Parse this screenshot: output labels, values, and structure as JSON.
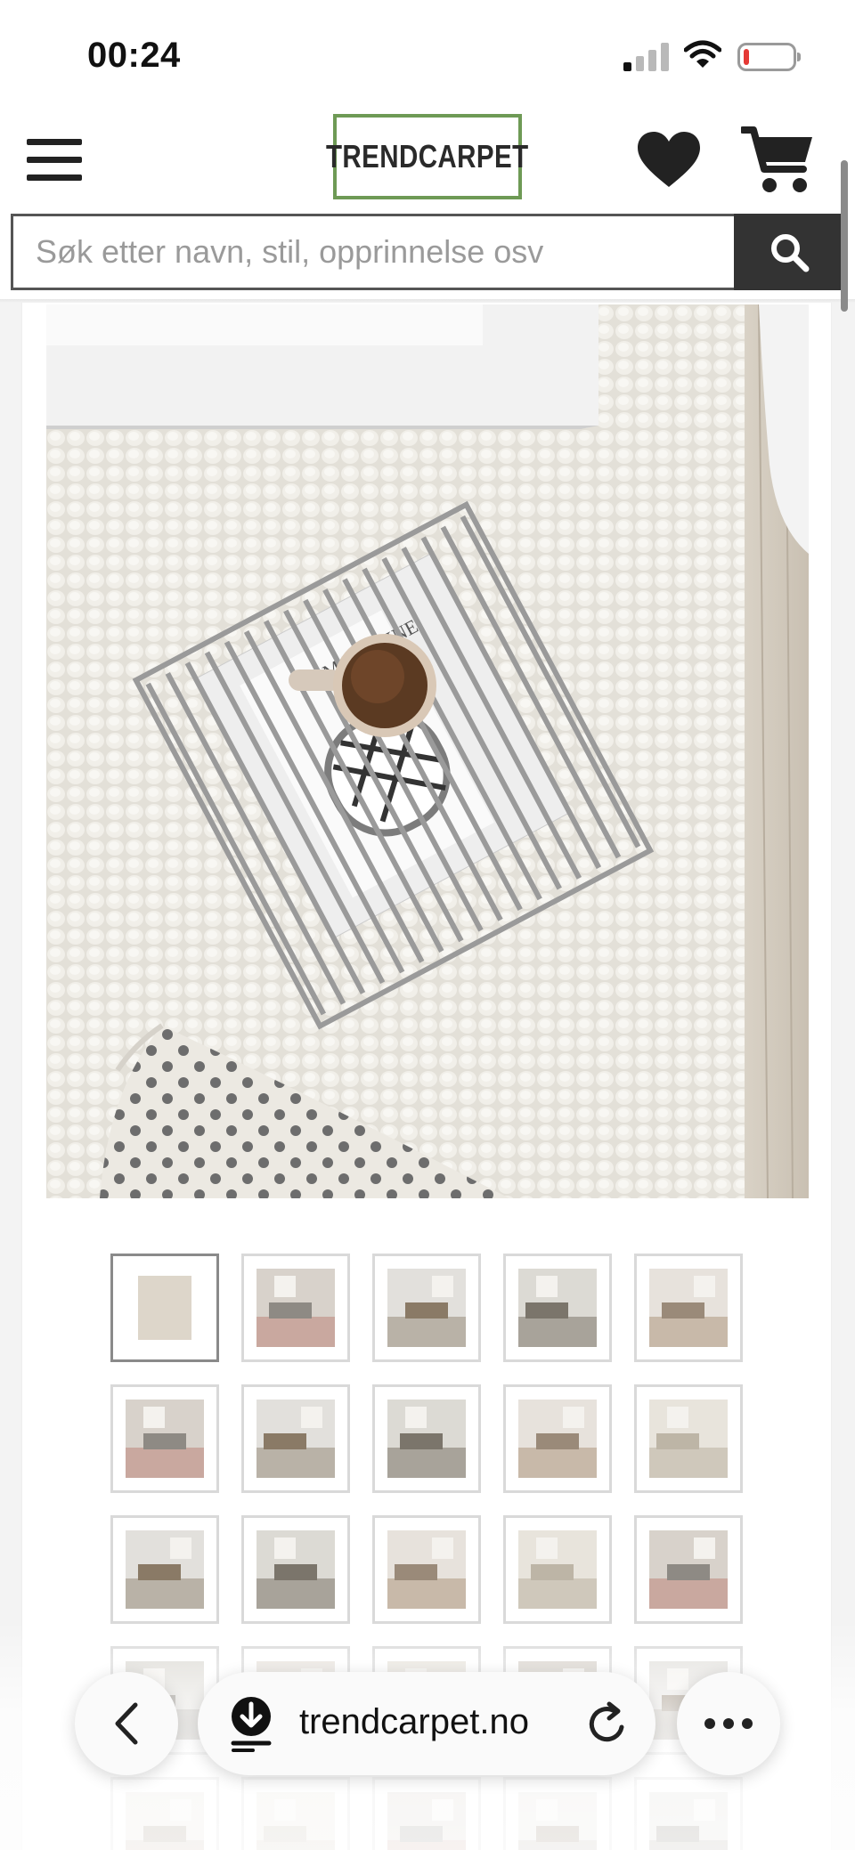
{
  "status_bar": {
    "time": "00:24",
    "signal_icon": "cellular-signal-icon",
    "wifi_icon": "wifi-icon",
    "battery_icon": "battery-low-icon",
    "battery_level": 0.1,
    "battery_color": "#e53935"
  },
  "header": {
    "menu_icon": "hamburger-menu-icon",
    "logo_text": "TRENDCARPET",
    "logo_border_color": "#6e9a55",
    "wishlist_icon": "heart-icon",
    "cart_icon": "shopping-cart-icon"
  },
  "search": {
    "placeholder": "Søk etter navn, stil, opprinnelse osv",
    "value": "",
    "button_icon": "search-icon",
    "button_color": "#333333"
  },
  "gallery": {
    "main_image_label": "product-image-rug-top-view",
    "thumbnails": [
      {
        "scene": "rug-product-shot",
        "active": true
      },
      {
        "scene": "living-room-pink-sofa"
      },
      {
        "scene": "living-room-coffee-table"
      },
      {
        "scene": "room-with-side-table"
      },
      {
        "scene": "living-room-white-sofa"
      },
      {
        "scene": "living-room-grey-sofa"
      },
      {
        "scene": "rug-with-armchair"
      },
      {
        "scene": "living-room-white-table"
      },
      {
        "scene": "living-room-wide"
      },
      {
        "scene": "living-room-dark-table"
      },
      {
        "scene": "rug-top-view-basket"
      },
      {
        "scene": "kitchen-with-rug"
      },
      {
        "scene": "bright-living-room-plant"
      },
      {
        "scene": "sofa-with-cushions"
      },
      {
        "scene": "dining-room-rug"
      },
      {
        "scene": "interior-partial-1"
      },
      {
        "scene": "interior-partial-2"
      },
      {
        "scene": "interior-partial-3"
      },
      {
        "scene": "interior-partial-4"
      },
      {
        "scene": "dining-chairs-partial"
      },
      {
        "scene": "interior-partial-5"
      },
      {
        "scene": "interior-partial-6"
      },
      {
        "scene": "interior-partial-7"
      },
      {
        "scene": "interior-partial-8"
      },
      {
        "scene": "interior-partial-9"
      }
    ]
  },
  "browser": {
    "url": "trendcarpet.no",
    "back_icon": "chevron-left-icon",
    "download_icon": "download-icon",
    "reload_icon": "reload-icon",
    "more_icon": "more-dots-icon"
  }
}
